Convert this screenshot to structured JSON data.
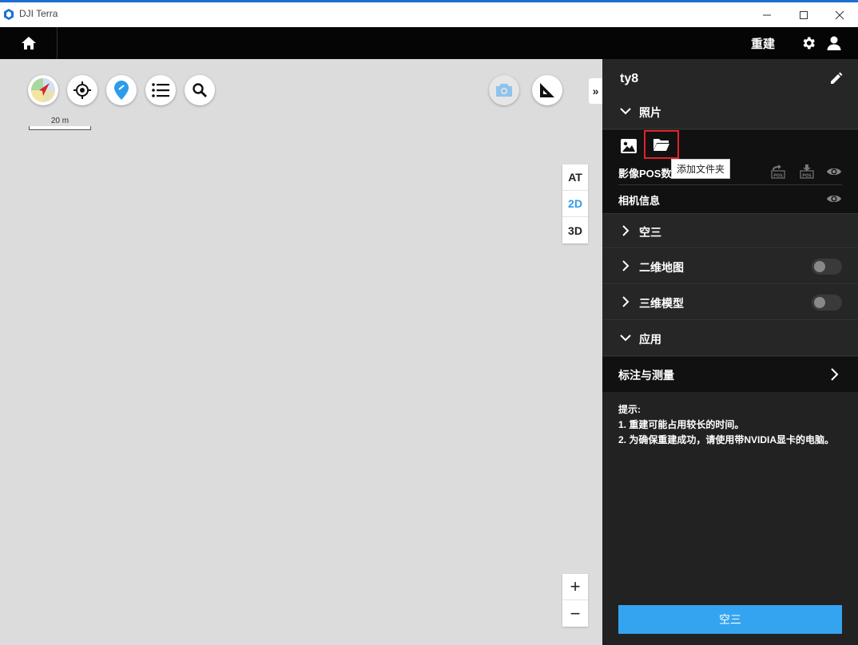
{
  "window": {
    "title": "DJI Terra"
  },
  "topbar": {
    "rebuild_label": "重建"
  },
  "map": {
    "scale_label": "20 m",
    "collapse_label": "»",
    "view_modes": [
      "AT",
      "2D",
      "3D"
    ],
    "active_view": "2D",
    "zoom_in": "+",
    "zoom_out": "−"
  },
  "panel": {
    "project_name": "ty8",
    "sections": {
      "photos": "照片",
      "aerotriangulation": "空三",
      "map2d": "二维地图",
      "model3d": "三维模型",
      "application": "应用"
    },
    "photo_rows": {
      "pos_data": "影像POS数",
      "camera_info": "相机信息"
    },
    "tooltip": "添加文件夹",
    "annotation": "标注与测量",
    "tips": {
      "title": "提示:",
      "line1": "1. 重建可能占用较长的时间。",
      "line2": "2. 为确保重建成功，请使用带NVIDIA显卡的电脑。"
    },
    "action_button": "空三"
  },
  "colors": {
    "accent": "#34a4f0",
    "active_view": "#2e9bea",
    "highlight_border": "#e0242a",
    "panel_bg": "#222222"
  }
}
